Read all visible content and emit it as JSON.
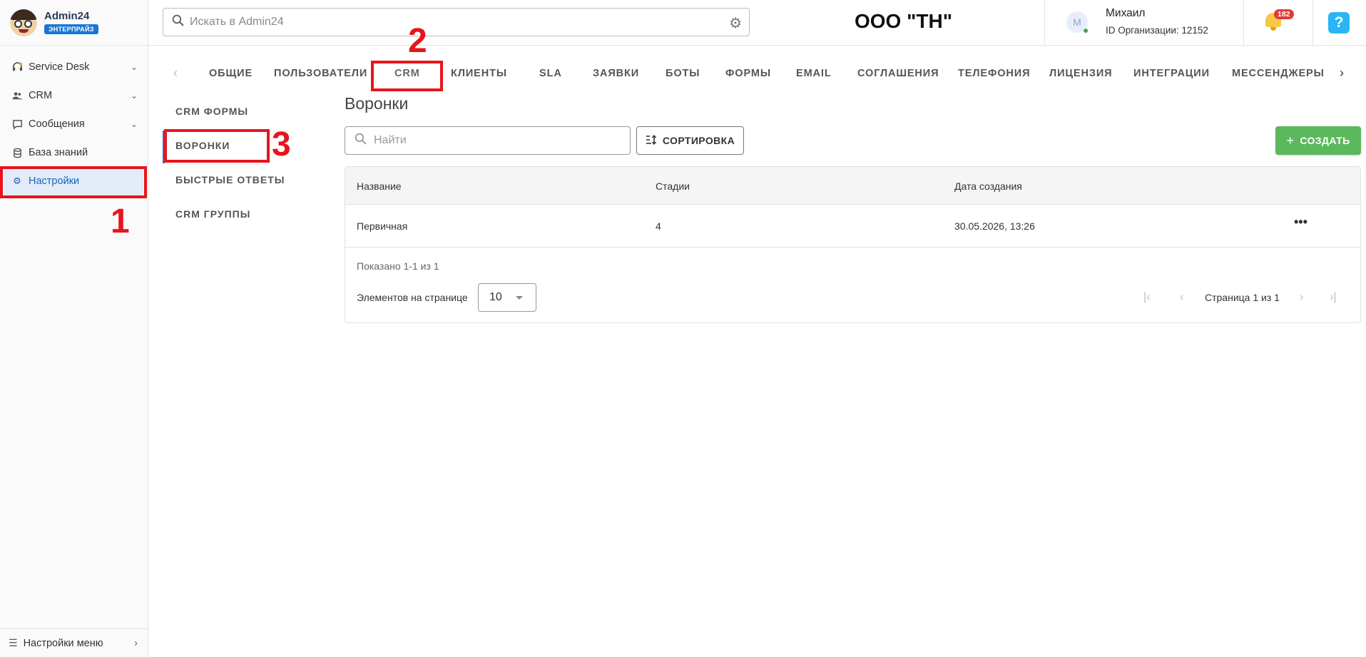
{
  "brand": {
    "name": "Admin24",
    "badge": "ЭНТЕРПРАЙЗ"
  },
  "sidebar": {
    "items": [
      {
        "label": "Service Desk",
        "icon": "headset-icon",
        "has_chevron": true
      },
      {
        "label": "CRM",
        "icon": "people-icon",
        "has_chevron": true
      },
      {
        "label": "Сообщения",
        "icon": "chat-icon",
        "has_chevron": true
      },
      {
        "label": "База знаний",
        "icon": "database-icon",
        "has_chevron": false
      },
      {
        "label": "Настройки",
        "icon": "gear-icon",
        "has_chevron": false,
        "active": true
      }
    ],
    "bottom_label": "Настройки меню"
  },
  "header": {
    "search_placeholder": "Искать в Admin24",
    "org_title": "ООО \"ТН\"",
    "user": {
      "initial": "М",
      "name": "Михаил",
      "org_id": "ID Организации: 12152"
    },
    "notifications_count": "182",
    "help_glyph": "?"
  },
  "tabs": {
    "items": [
      "ОБЩИЕ",
      "ПОЛЬЗОВАТЕЛИ",
      "CRM",
      "КЛИЕНТЫ",
      "SLA",
      "ЗАЯВКИ",
      "БОТЫ",
      "ФОРМЫ",
      "EMAIL",
      "СОГЛАШЕНИЯ",
      "ТЕЛЕФОНИЯ",
      "ЛИЦЕНЗИЯ",
      "ИНТЕГРАЦИИ",
      "МЕССЕНДЖЕРЫ"
    ],
    "active": "CRM"
  },
  "subnav": {
    "items": [
      "CRM ФОРМЫ",
      "ВОРОНКИ",
      "БЫСТРЫЕ ОТВЕТЫ",
      "CRM ГРУППЫ"
    ],
    "active": "ВОРОНКИ"
  },
  "content": {
    "title": "Воронки",
    "search_placeholder": "Найти",
    "sort_label": "СОРТИРОВКА",
    "create_label": "СОЗДАТЬ",
    "table": {
      "columns": [
        "Название",
        "Стадии",
        "Дата создания"
      ],
      "rows": [
        {
          "name": "Первичная",
          "stages": "4",
          "created": "30.05.2026, 13:26"
        }
      ]
    },
    "shown_text": "Показано 1-1 из 1",
    "per_page_label": "Элементов на странице",
    "per_page_value": "10",
    "page_label": "Страница 1 из 1"
  },
  "annotations": {
    "marker_1": "1",
    "marker_2": "2",
    "marker_3": "3",
    "color": "#e8141c"
  },
  "colors": {
    "accent": "#1976d2",
    "create_button": "#5cb85c",
    "badge_red": "#e53935",
    "help_blue": "#29b6f6"
  }
}
